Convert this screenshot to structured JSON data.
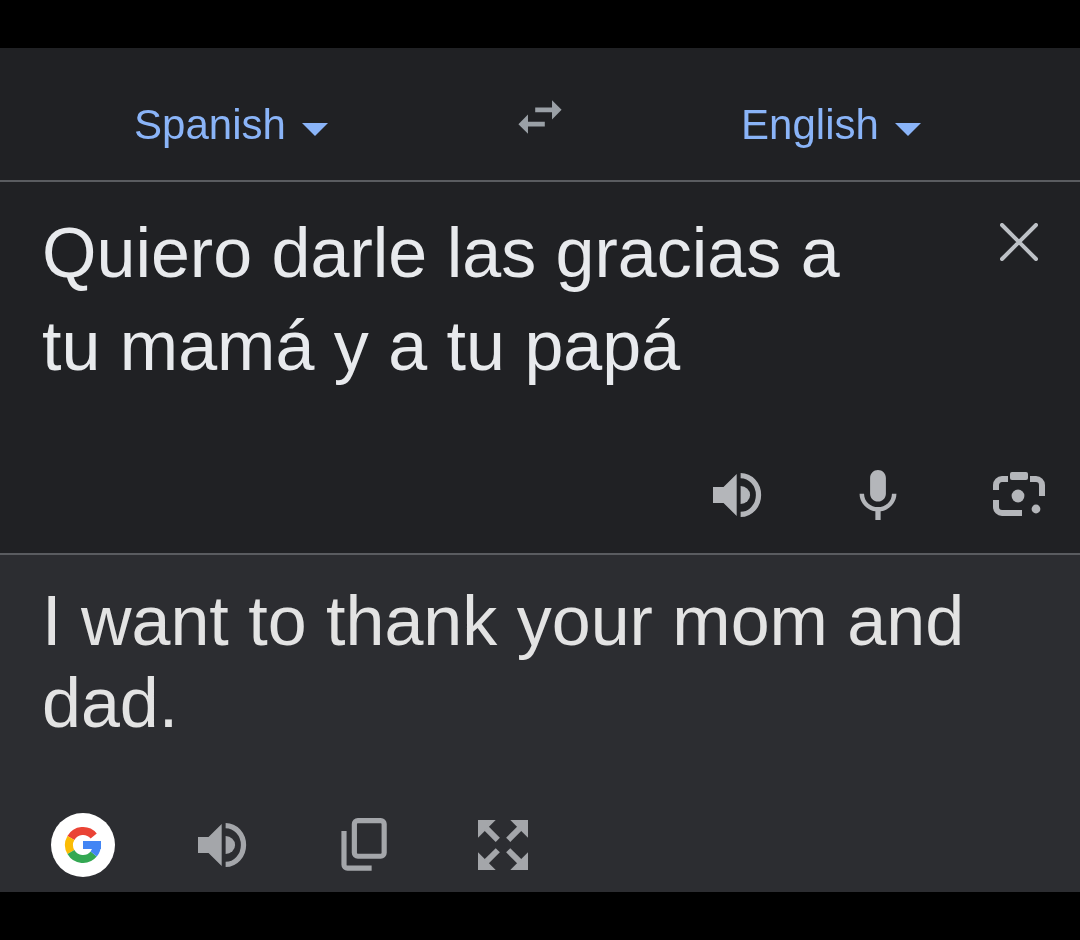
{
  "language_bar": {
    "source_language": {
      "label": "Spanish"
    },
    "target_language": {
      "label": "English"
    }
  },
  "input": {
    "value": "Quiero darle las gracias a tu mamá y a tu papá"
  },
  "translation": {
    "text": "I want to thank your mom and dad."
  }
}
